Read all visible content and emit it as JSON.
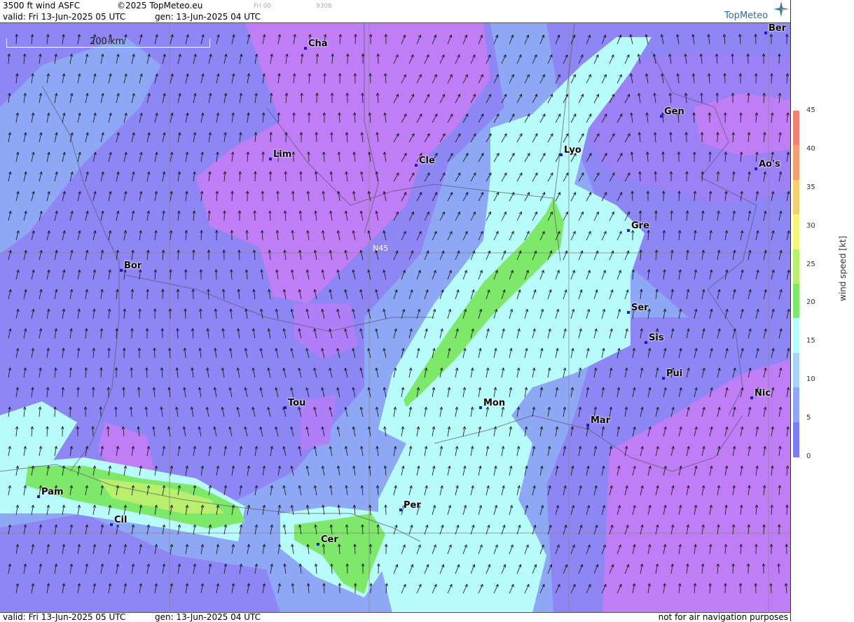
{
  "header": {
    "product": "3500 ft wind ASFC",
    "copyright": "©2025 TopMeteo.eu",
    "frame_day": "Fri 00",
    "frame_code": "9306",
    "valid": "valid:  Fri  13-Jun-2025  05 UTC",
    "gen": "gen: 13-Jun-2025 04 UTC"
  },
  "logo": {
    "text": "TopMeteo",
    "icon": "compass-star-icon"
  },
  "map": {
    "scale_label": "200 km",
    "grid_label": "N45",
    "cities": [
      "Cha",
      "Ber",
      "Gen",
      "Lim",
      "Cle",
      "Lyo",
      "Ao's",
      "Gre",
      "Bor",
      "Ser",
      "Sis",
      "Pui",
      "Nic",
      "Tou",
      "Mon",
      "Mar",
      "Pam",
      "Cil",
      "Per",
      "Cer"
    ]
  },
  "legend": {
    "title": "wind speed [kt]",
    "ticks": [
      "45",
      "40",
      "35",
      "30",
      "25",
      "20",
      "15",
      "10",
      "5",
      "0"
    ],
    "colors": [
      "#f08070",
      "#f2a070",
      "#f3d070",
      "#f6f57a",
      "#b8ef6c",
      "#7ee86a",
      "#b8fbfb",
      "#a8d4fa",
      "#8fa8f5",
      "#7f7df5",
      "#c07ef6"
    ]
  },
  "footer": {
    "valid": "valid:  Fri  13-Jun-2025  05 UTC",
    "gen": "gen: 13-Jun-2025 04 UTC",
    "note": "not for air navigation purposes"
  }
}
